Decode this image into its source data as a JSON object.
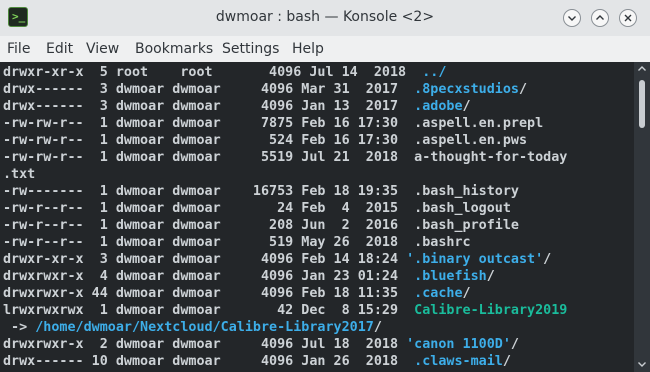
{
  "window": {
    "title": "dwmoar : bash — Konsole <2>",
    "app_icon_glyph": ">_"
  },
  "menu": [
    "File",
    "Edit",
    "View",
    "Bookmarks",
    "Settings",
    "Help"
  ],
  "colors": {
    "terminal_bg": "#232629",
    "text": "#cdd2d6",
    "directory": "#3daee9",
    "symlink": "#1abc9c"
  },
  "terminal_lines": [
    [
      {
        "t": "drwxr-xr-x  5 root    root       4096 Jul 14  2018  ",
        "c": "default"
      },
      {
        "t": "../",
        "c": "dir"
      }
    ],
    [
      {
        "t": "drwx------  3 dwmoar dwmoar     4096 Mar 31  2017  ",
        "c": "default"
      },
      {
        "t": ".8pecxstudios",
        "c": "dir"
      },
      {
        "t": "/",
        "c": "default"
      }
    ],
    [
      {
        "t": "drwx------  3 dwmoar dwmoar     4096 Jan 13  2017  ",
        "c": "default"
      },
      {
        "t": ".adobe",
        "c": "dir"
      },
      {
        "t": "/",
        "c": "default"
      }
    ],
    [
      {
        "t": "-rw-rw-r--  1 dwmoar dwmoar     7875 Feb 16 17:30  .aspell.en.prepl",
        "c": "default"
      }
    ],
    [
      {
        "t": "-rw-rw-r--  1 dwmoar dwmoar      524 Feb 16 17:30  .aspell.en.pws",
        "c": "default"
      }
    ],
    [
      {
        "t": "-rw-rw-r--  1 dwmoar dwmoar     5519 Jul 21  2018  a-thought-for-today",
        "c": "default"
      }
    ],
    [
      {
        "t": ".txt",
        "c": "default"
      }
    ],
    [
      {
        "t": "-rw-------  1 dwmoar dwmoar    16753 Feb 18 19:35  .bash_history",
        "c": "default"
      }
    ],
    [
      {
        "t": "-rw-r--r--  1 dwmoar dwmoar       24 Feb  4  2015  .bash_logout",
        "c": "default"
      }
    ],
    [
      {
        "t": "-rw-r--r--  1 dwmoar dwmoar      208 Jun  2  2016  .bash_profile",
        "c": "default"
      }
    ],
    [
      {
        "t": "-rw-r--r--  1 dwmoar dwmoar      519 May 26  2018  .bashrc",
        "c": "default"
      }
    ],
    [
      {
        "t": "drwxr-xr-x  3 dwmoar dwmoar     4096 Feb 14 18:24 ",
        "c": "default"
      },
      {
        "t": "'.binary outcast'",
        "c": "dir"
      },
      {
        "t": "/",
        "c": "default"
      }
    ],
    [
      {
        "t": "drwxrwxr-x  4 dwmoar dwmoar     4096 Jan 23 01:24  ",
        "c": "default"
      },
      {
        "t": ".bluefish",
        "c": "dir"
      },
      {
        "t": "/",
        "c": "default"
      }
    ],
    [
      {
        "t": "drwxrwxr-x 44 dwmoar dwmoar     4096 Feb 18 11:35  ",
        "c": "default"
      },
      {
        "t": ".cache",
        "c": "dir"
      },
      {
        "t": "/",
        "c": "default"
      }
    ],
    [
      {
        "t": "lrwxrwxrwx  1 dwmoar dwmoar       42 Dec  8 15:29  ",
        "c": "default"
      },
      {
        "t": "Calibre-Library2019",
        "c": "link"
      }
    ],
    [
      {
        "t": " -> ",
        "c": "default"
      },
      {
        "t": "/home/dwmoar/Nextcloud/Calibre-Library2017",
        "c": "dir"
      },
      {
        "t": "/",
        "c": "default"
      }
    ],
    [
      {
        "t": "drwxrwxr-x  2 dwmoar dwmoar     4096 Jul 18  2018 ",
        "c": "default"
      },
      {
        "t": "'canon 1100D'",
        "c": "dir"
      },
      {
        "t": "/",
        "c": "default"
      }
    ],
    [
      {
        "t": "drwx------ 10 dwmoar dwmoar     4096 Jan 26  2018  ",
        "c": "default"
      },
      {
        "t": ".claws-mail",
        "c": "dir"
      },
      {
        "t": "/",
        "c": "default"
      }
    ]
  ]
}
